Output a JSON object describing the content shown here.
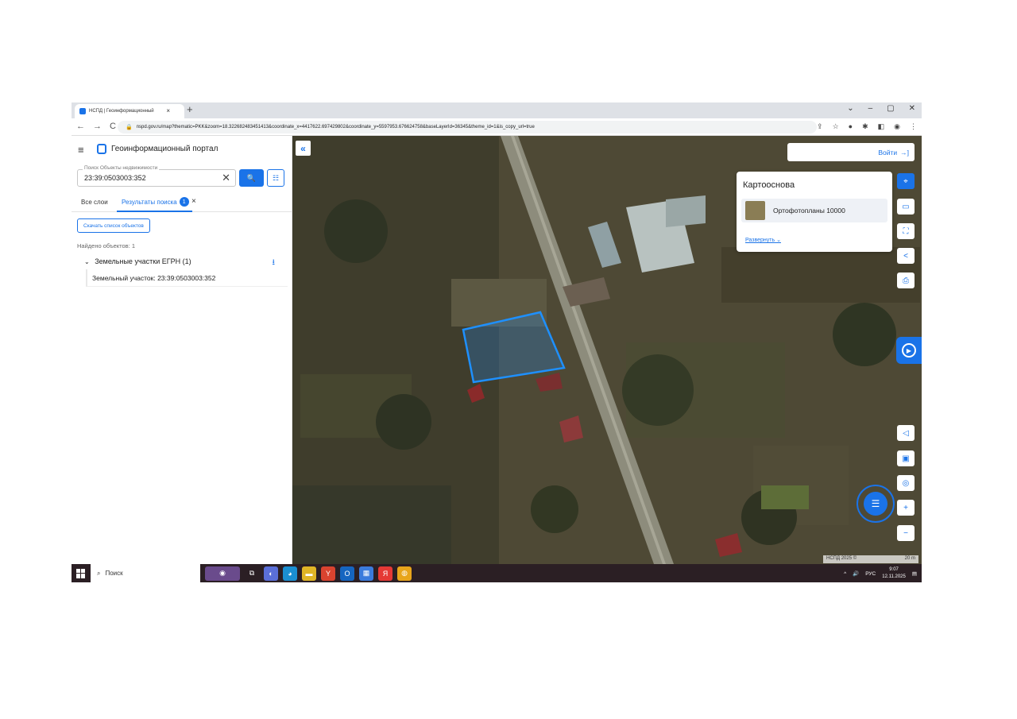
{
  "browser": {
    "tab_title": "НСПД | Геоинформационный",
    "tab_close": "×",
    "new_tab": "+",
    "window_controls": [
      "⌄",
      "–",
      "▢",
      "✕"
    ],
    "nav": [
      "←",
      "→",
      "C"
    ],
    "url": "nspd.gov.ru/map?thematic=PKK&zoom=18.322682483451413&coordinate_x=4417622.697429802&coordinate_y=5597953.676624758&baseLayerId=36345&theme_id=1&is_copy_url=true"
  },
  "panel": {
    "menu_icon": "≡",
    "portal_title": "Геоинформационный портал",
    "search": {
      "label": "Поиск Объекты недвижимости",
      "value": "23:39:0503003:352",
      "clear": "✕",
      "button_icon": "🔍",
      "filter_icon": "☷"
    },
    "tabs": {
      "all_layers": "Все слои",
      "results": "Результаты поиска",
      "results_count": "1",
      "close": "×"
    },
    "download_list": "Скачать список объектов",
    "found": "Найдено объектов: 1",
    "group": {
      "chevron": "⌄",
      "label": "Земельные участки ЕГРН (1)",
      "download_icon": "⭳"
    },
    "item": "Земельный участок: 23:39:0503003:352"
  },
  "map": {
    "collapse": "«",
    "login": "Войти",
    "login_icon": "→]",
    "basemap": {
      "title": "Картооснова",
      "option": "Ортофотопланы 10000",
      "expand": "Развернуть",
      "expand_icon": "⌄"
    },
    "tools": [
      "⌖",
      "▭",
      "⛶",
      "<",
      "⎙"
    ],
    "bottom_tools": [
      "◁",
      "▣",
      "◎",
      "+",
      "−"
    ],
    "side_badge_icon": "▶",
    "chat_icon": "☰",
    "scale_left": "НСПД 2025 ©",
    "scale_right": "20 m",
    "parcel_color": "#1e90ff"
  },
  "taskbar": {
    "search": "Поиск",
    "search_icon": "⌕",
    "tray_arrow": "^",
    "sound_icon": "🔊",
    "lang": "РУС",
    "time": "9:07",
    "date": "12.11.2025",
    "notif_icon": "▤"
  }
}
